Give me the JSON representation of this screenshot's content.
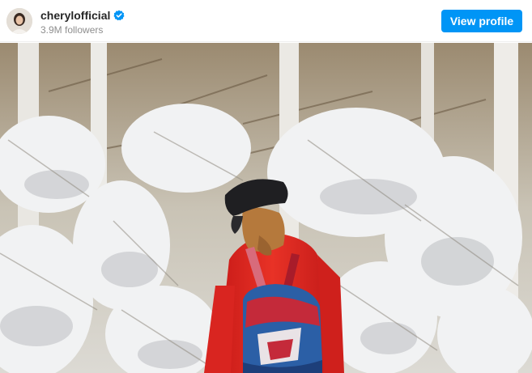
{
  "header": {
    "username": "cherylofficial",
    "followers": "3.9M followers",
    "verified_icon": "verified-badge-icon",
    "view_profile_label": "View profile"
  },
  "colors": {
    "accent": "#0095f6",
    "jacket": "#e3231f",
    "hat": "#1f1f22",
    "hair": "#b5793c",
    "backpack_red": "#c42a3a",
    "backpack_blue": "#2b5fa6"
  },
  "post": {
    "image_subject": "photo-snowy-forest"
  }
}
